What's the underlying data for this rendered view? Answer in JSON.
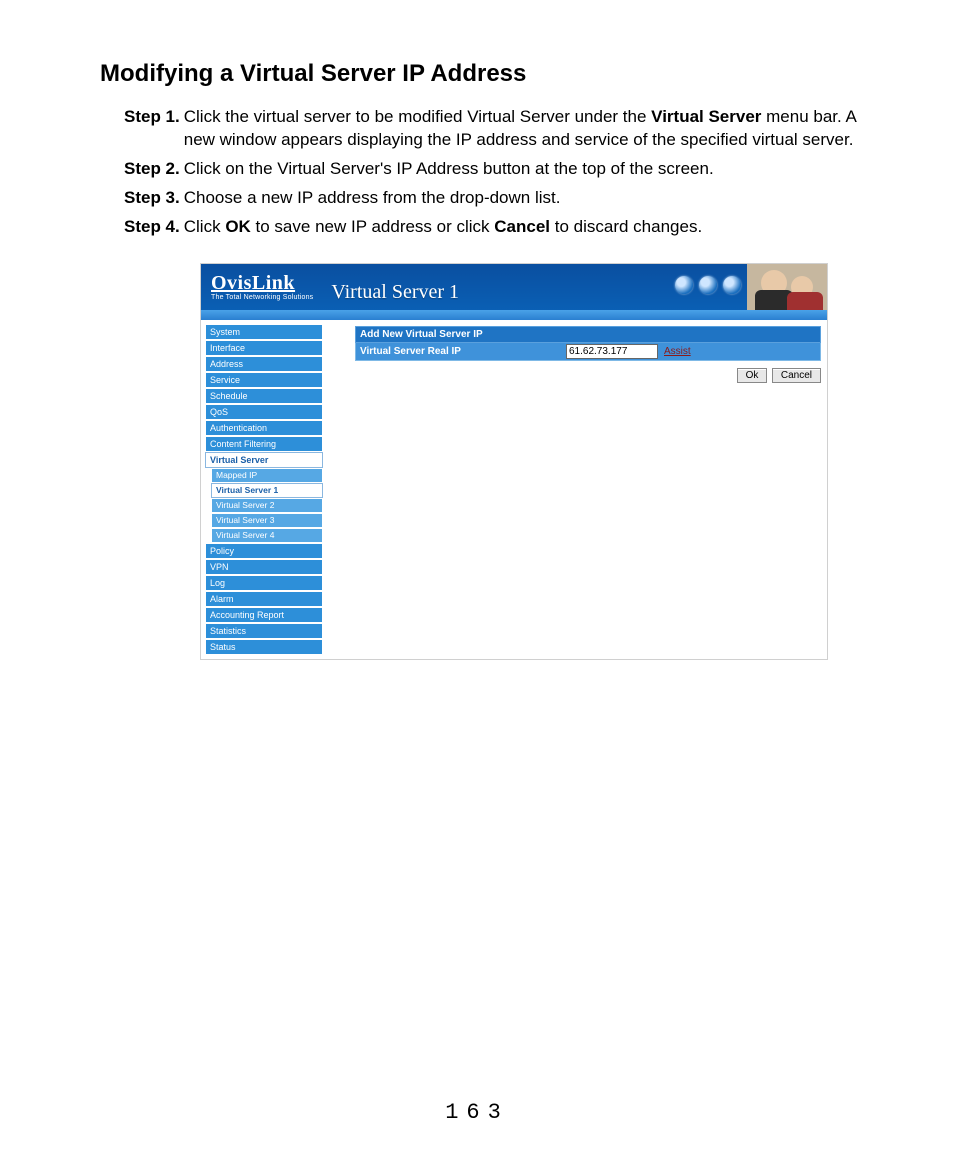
{
  "doc": {
    "title": "Modifying a Virtual Server IP Address",
    "steps": [
      {
        "label": "Step 1.",
        "pre": "Click the virtual server to be modified Virtual Server under the ",
        "bold1": "Virtual Server",
        "post": " menu bar. A new window appears displaying the IP address and service of the specified virtual server."
      },
      {
        "label": "Step 2.",
        "text": "Click on the Virtual Server's IP Address button at the top of the screen."
      },
      {
        "label": "Step 3.",
        "text": "Choose a new IP address from the drop-down list."
      },
      {
        "label": "Step 4.",
        "pre": "Click ",
        "bold1": "OK",
        "mid": " to save new IP address or click ",
        "bold2": "Cancel",
        "post": " to discard changes."
      }
    ],
    "page_number": "163"
  },
  "app": {
    "brand": "OvisLink",
    "brand_sub": "The Total Networking Solutions",
    "page_title": "Virtual Server 1",
    "sidebar": {
      "items": [
        {
          "label": "System"
        },
        {
          "label": "Interface"
        },
        {
          "label": "Address"
        },
        {
          "label": "Service"
        },
        {
          "label": "Schedule"
        },
        {
          "label": "QoS"
        },
        {
          "label": "Authentication"
        },
        {
          "label": "Content Filtering"
        },
        {
          "label": "Virtual Server",
          "selected": true,
          "children": [
            {
              "label": "Mapped IP"
            },
            {
              "label": "Virtual Server 1",
              "selected": true
            },
            {
              "label": "Virtual Server 2"
            },
            {
              "label": "Virtual Server 3"
            },
            {
              "label": "Virtual Server 4"
            }
          ]
        },
        {
          "label": "Policy"
        },
        {
          "label": "VPN"
        },
        {
          "label": "Log"
        },
        {
          "label": "Alarm"
        },
        {
          "label": "Accounting Report"
        },
        {
          "label": "Statistics"
        },
        {
          "label": "Status"
        }
      ]
    },
    "panel": {
      "header": "Add New Virtual Server IP",
      "field_label": "Virtual Server Real IP",
      "ip_value": "61.62.73.177",
      "assist": "Assist",
      "ok": "Ok",
      "cancel": "Cancel"
    }
  }
}
